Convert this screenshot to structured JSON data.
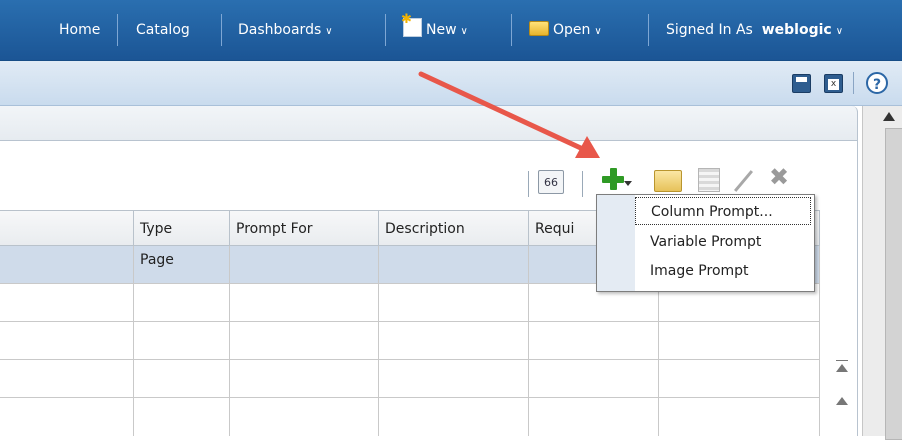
{
  "nav": {
    "home": "Home",
    "catalog": "Catalog",
    "dashboards": "Dashboards",
    "new": "New",
    "open": "Open",
    "signed_in_as": "Signed In As",
    "username": "weblogic"
  },
  "table": {
    "headers": [
      "Type",
      "Prompt For",
      "Description",
      "Requi"
    ],
    "selected_row_type": "Page"
  },
  "menu": {
    "items": [
      "Column Prompt...",
      "Variable Prompt",
      "Image Prompt"
    ]
  },
  "icons": {
    "preview": "preview-icon",
    "add": "add-plus-icon",
    "edit": "edit-icon",
    "delete": "delete-icon",
    "help": "help-icon",
    "save": "save-icon",
    "save_as": "save-as-icon"
  },
  "colors": {
    "nav_bg": "#1f5e9f",
    "toolbar_bg": "#d3e2f1",
    "selected_row": "#cfdbea",
    "arrow": "#e8574a",
    "add_green": "#2f9a25"
  }
}
